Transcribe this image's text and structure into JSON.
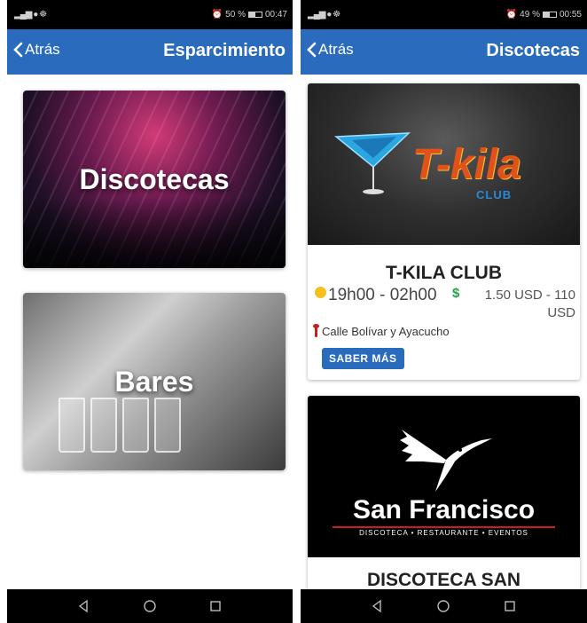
{
  "left": {
    "status": {
      "icons": "▂▄▆ ● ☸",
      "alarm": "⏰",
      "battery_text": "50 %",
      "battery_pct": 50,
      "time": "00:47"
    },
    "appbar": {
      "back_label": "Atrás",
      "title": "Esparcimiento"
    },
    "categories": [
      {
        "label": "Discotecas"
      },
      {
        "label": "Bares"
      }
    ]
  },
  "right": {
    "status": {
      "icons": "▂▄▆ ● ☸",
      "alarm": "⏰",
      "battery_text": "49 %",
      "battery_pct": 49,
      "time": "00:55"
    },
    "appbar": {
      "back_label": "Atrás",
      "title": "Discotecas"
    },
    "clubs": [
      {
        "logo_text": "T-kila",
        "logo_sub": "CLUB",
        "name": "T-KILA CLUB",
        "hours": "19h00 - 02h00",
        "price_symbol": "$",
        "price": "1.50 USD - 110 USD",
        "address": "Calle Bolívar y Ayacucho",
        "button": "SABER MÁS"
      },
      {
        "logo_text": "San Francisco",
        "logo_sub": "DISCOTECA • RESTAURANTE • EVENTOS",
        "name": "DISCOTECA SAN"
      }
    ]
  },
  "colors": {
    "primary": "#2a6bbd",
    "price_green": "#24a148",
    "pin_red": "#c81e1e",
    "clock_yellow": "#f2c11a"
  },
  "icons": [
    "back-chevron-icon",
    "clock-icon",
    "dollar-icon",
    "location-pin-icon",
    "nav-back-icon",
    "nav-home-icon",
    "nav-recents-icon"
  ]
}
